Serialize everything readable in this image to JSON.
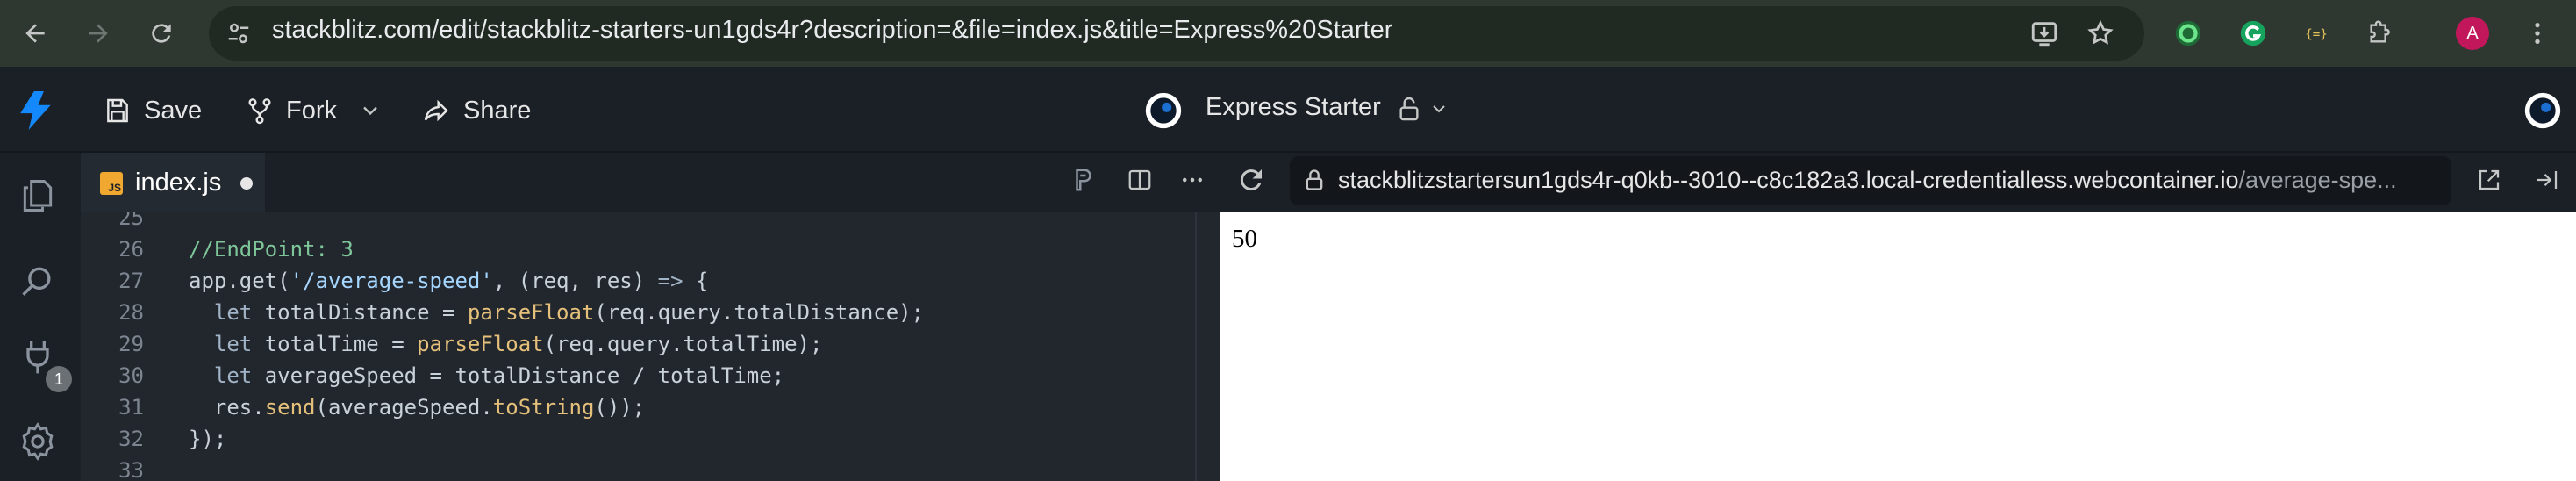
{
  "browser": {
    "url_main": "stackblitz.com/edit/stackblitz-starters-un1gds4r?description=&file=index.js&title=Express%20Starter",
    "profile_initial": "A",
    "icons": [
      "back-icon",
      "forward-icon",
      "reload-icon",
      "site-settings-icon",
      "install-app-icon",
      "bookmark-star-icon",
      "extension-green-ring-icon",
      "grammarly-icon",
      "json-extension-icon",
      "extensions-puzzle-icon",
      "profile-avatar",
      "kebab-menu-icon"
    ]
  },
  "header": {
    "save_label": "Save",
    "fork_label": "Fork",
    "share_label": "Share",
    "project_title": "Express Starter"
  },
  "activity": {
    "badge_count": "1"
  },
  "editor": {
    "tab_label": "index.js",
    "tab_icon_text": "JS",
    "lines": [
      {
        "n": "25",
        "tokens": []
      },
      {
        "n": "26",
        "tokens": [
          {
            "t": "//EndPoint: 3",
            "c": "c-comment"
          }
        ]
      },
      {
        "n": "27",
        "tokens": [
          {
            "t": "app",
            "c": ""
          },
          {
            "t": ".get(",
            "c": ""
          },
          {
            "t": "'/average-speed'",
            "c": "c-str"
          },
          {
            "t": ", (req, res) ",
            "c": ""
          },
          {
            "t": "=>",
            "c": "c-kw"
          },
          {
            "t": " {",
            "c": ""
          }
        ]
      },
      {
        "n": "28",
        "tokens": [
          {
            "t": "  let ",
            "c": "c-kw"
          },
          {
            "t": "totalDistance = ",
            "c": ""
          },
          {
            "t": "parseFloat",
            "c": "c-fn"
          },
          {
            "t": "(req.query.totalDistance);",
            "c": ""
          }
        ]
      },
      {
        "n": "29",
        "tokens": [
          {
            "t": "  let ",
            "c": "c-kw"
          },
          {
            "t": "totalTime = ",
            "c": ""
          },
          {
            "t": "parseFloat",
            "c": "c-fn"
          },
          {
            "t": "(req.query.totalTime);",
            "c": ""
          }
        ]
      },
      {
        "n": "30",
        "tokens": [
          {
            "t": "  let ",
            "c": "c-kw"
          },
          {
            "t": "averageSpeed = totalDistance / totalTime;",
            "c": ""
          }
        ]
      },
      {
        "n": "31",
        "tokens": [
          {
            "t": "  res.",
            "c": ""
          },
          {
            "t": "send",
            "c": "c-fn"
          },
          {
            "t": "(averageSpeed.",
            "c": ""
          },
          {
            "t": "toString",
            "c": "c-fn"
          },
          {
            "t": "());",
            "c": ""
          }
        ]
      },
      {
        "n": "32",
        "tokens": [
          {
            "t": "});",
            "c": ""
          }
        ]
      },
      {
        "n": "33",
        "tokens": []
      }
    ]
  },
  "preview": {
    "url_main": "stackblitzstartersun1gds4r-q0kb--3010--c8c182a3.local-credentialless.webcontainer.io",
    "url_path": "/average-spe...",
    "body_text": "50"
  }
}
